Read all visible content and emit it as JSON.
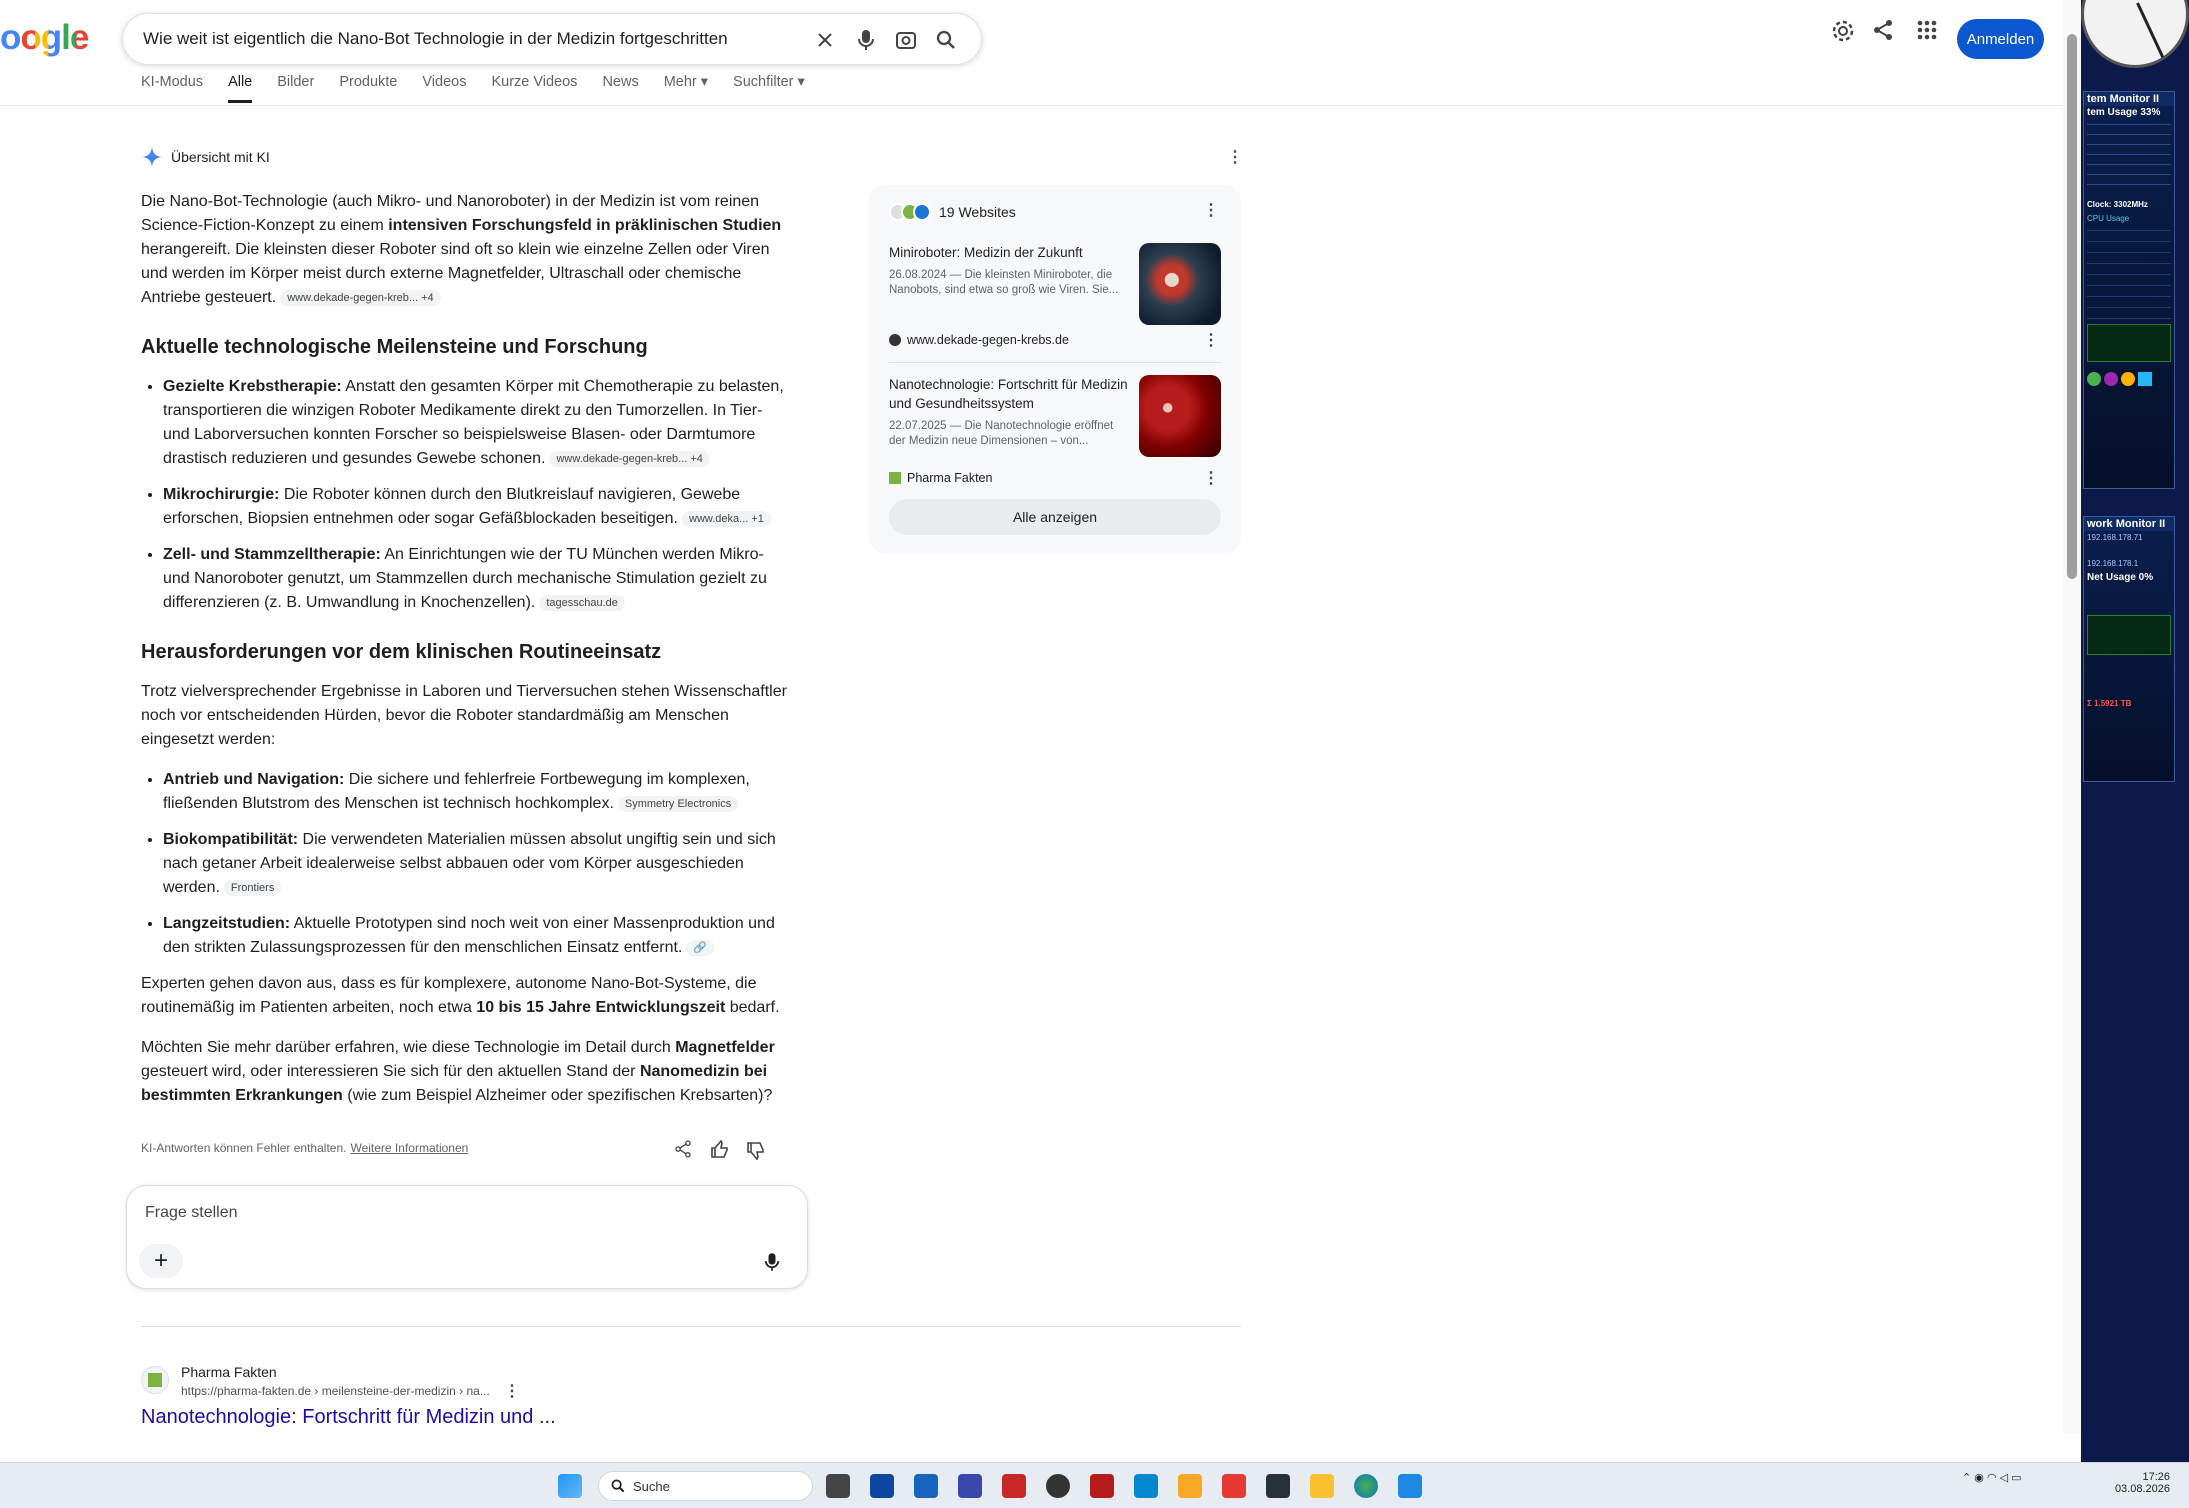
{
  "search": {
    "query": "Wie weit ist eigentlich die Nano-Bot Technologie in der Medizin fortgeschritten"
  },
  "logo_text": "oogle",
  "tabs": [
    "KI-Modus",
    "Alle",
    "Bilder",
    "Produkte",
    "Videos",
    "Kurze Videos",
    "News",
    "Mehr ▾",
    "Suchfilter ▾"
  ],
  "active_tab": "Alle",
  "header": {
    "signin_label": "Anmelden"
  },
  "ai_overview": {
    "header": "Übersicht mit KI",
    "intro": {
      "t1": "Die Nano-Bot-Technologie (auch Mikro- und Nanoroboter) in der Medizin ist vom reinen Science-Fiction-Konzept zu einem ",
      "b1": "intensiven Forschungsfeld in präklinischen Studien",
      "t2": " herangereift. Die kleinsten dieser Roboter sind oft so klein wie einzelne Zellen oder Viren und werden im Körper meist durch externe Magnetfelder, Ultraschall oder chemische Antriebe gesteuert.",
      "chip": "www.dekade-gegen-kreb... +4"
    },
    "h1": "Aktuelle technologische Meilensteine und Forschung",
    "milestones": [
      {
        "b": "Gezielte Krebstherapie:",
        "t": " Anstatt den gesamten Körper mit Chemotherapie zu belasten, transportieren die winzigen Roboter Medikamente direkt zu den Tumorzellen. In Tier- und Laborversuchen konnten Forscher so beispielsweise Blasen- oder Darmtumore drastisch reduzieren und gesundes Gewebe schonen.",
        "chip": "www.dekade-gegen-kreb... +4"
      },
      {
        "b": "Mikrochirurgie:",
        "t": " Die Roboter können durch den Blutkreislauf navigieren, Gewebe erforschen, Biopsien entnehmen oder sogar Gefäßblockaden beseitigen.",
        "chip": "www.deka... +1"
      },
      {
        "b": "Zell- und Stammzelltherapie:",
        "t": " An Einrichtungen wie der TU München werden Mikro- und Nanoroboter genutzt, um Stammzellen durch mechanische Stimulation gezielt zu differenzieren (z. B. Umwandlung in Knochenzellen).",
        "chip": "tagesschau.de"
      }
    ],
    "h2": "Herausforderungen vor dem klinischen Routineeinsatz",
    "challenges_intro": "Trotz vielversprechender Ergebnisse in Laboren und Tierversuchen stehen Wissenschaftler noch vor entscheidenden Hürden, bevor die Roboter standardmäßig am Menschen eingesetzt werden:",
    "challenges": [
      {
        "b": "Antrieb und Navigation:",
        "t": " Die sichere und fehlerfreie Fortbewegung im komplexen, fließenden Blutstrom des Menschen ist technisch hochkomplex.",
        "chip": "Symmetry Electronics"
      },
      {
        "b": "Biokompatibilität:",
        "t": " Die verwendeten Materialien müssen absolut ungiftig sein und sich nach getaner Arbeit idealerweise selbst abbauen oder vom Körper ausgeschieden werden.",
        "chip": "Frontiers"
      },
      {
        "b": "Langzeitstudien:",
        "t": " Aktuelle Prototypen sind noch weit von einer Massenproduktion und den strikten Zulassungsprozessen für den menschlichen Einsatz entfernt.",
        "chip": "🔗"
      }
    ],
    "outlook": {
      "t1": "Experten gehen davon aus, dass es für komplexere, autonome Nano-Bot-Systeme, die routinemäßig im Patienten arbeiten, noch etwa ",
      "b1": "10 bis 15 Jahre Entwicklungszeit",
      "t2": " bedarf."
    },
    "question": {
      "t1": "Möchten Sie mehr darüber erfahren, wie diese Technologie im Detail durch ",
      "b1": "Magnetfelder",
      "t2": " gesteuert wird, oder interessieren Sie sich für den aktuellen Stand der ",
      "b2": "Nanomedizin bei bestimmten Erkrankungen",
      "t3": " (wie zum Beispiel Alzheimer oder spezifischen Krebsarten)?"
    },
    "disclaimer": "KI-Antworten können Fehler enthalten.",
    "more_info": "Weitere Informationen"
  },
  "ask": {
    "placeholder": "Frage stellen"
  },
  "sources_panel": {
    "count": "19 Websites",
    "cards": [
      {
        "title": "Miniroboter: Medizin der Zukunft",
        "desc": "26.08.2024 — Die kleinsten Miniroboter, die Nanobots, sind etwa so groß wie Viren. Sie...",
        "source": "www.dekade-gegen-krebs.de"
      },
      {
        "title": "Nanotechnologie: Fortschritt für Medizin und Gesundheitssystem",
        "desc": "22.07.2025 — Die Nanotechnologie eröffnet der Medizin neue Dimensionen – von...",
        "source": "Pharma Fakten"
      }
    ],
    "show_all": "Alle anzeigen"
  },
  "result": {
    "site": "Pharma Fakten",
    "url": "https://pharma-fakten.de › meilensteine-der-medizin › na...",
    "title": "Nanotechnologie: Fortschritt für Medizin und ..."
  },
  "gadgets": {
    "system_title": "tem Monitor II",
    "system_usage": "tem Usage   33%",
    "cpu_clock": "Clock:   3302MHz",
    "cpu_usage": "CPU Usage",
    "network_title": "work Monitor II",
    "ip1": "192.168.178.71",
    "ip2": "192.168.178.1",
    "net_usage": "Net Usage   0%",
    "total_tb": "Σ 1.5921 TB"
  },
  "taskbar": {
    "search": "Suche",
    "time": "17:26",
    "date": "03.08.2026"
  }
}
